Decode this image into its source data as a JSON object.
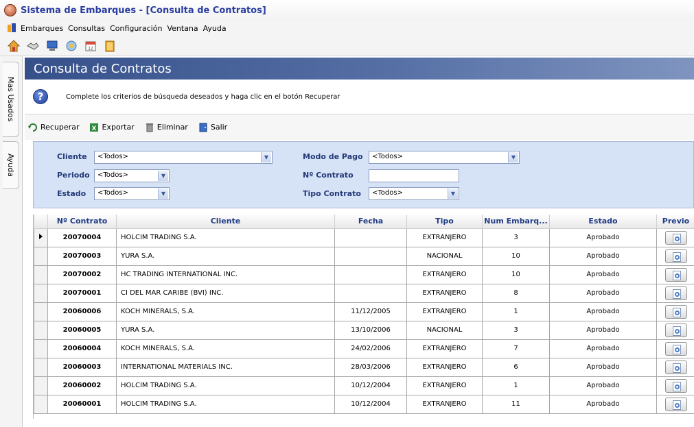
{
  "window": {
    "title": "Sistema de Embarques - [Consulta de Contratos]"
  },
  "menu": [
    "Embarques",
    "Consultas",
    "Configuración",
    "Ventana",
    "Ayuda"
  ],
  "toolbar_icons": [
    "home-icon",
    "handshake-icon",
    "computer-icon",
    "gear-globe-icon",
    "calendar-icon",
    "notebook-icon"
  ],
  "side_tabs": {
    "mas_usados": "Mas Usados",
    "ayuda": "Ayuda"
  },
  "header": {
    "title": "Consulta de Contratos"
  },
  "info": {
    "text": "Complete los criterios de búsqueda deseados y haga clic en el botón Recuperar"
  },
  "actions": {
    "recuperar": "Recuperar",
    "exportar": "Exportar",
    "eliminar": "Eliminar",
    "salir": "Salir"
  },
  "filters": {
    "cliente_label": "Cliente",
    "cliente_value": "<Todos>",
    "periodo_label": "Periodo",
    "periodo_value": "<Todos>",
    "estado_label": "Estado",
    "estado_value": "<Todos>",
    "modo_pago_label": "Modo de Pago",
    "modo_pago_value": "<Todos>",
    "nro_contrato_label": "Nº Contrato",
    "nro_contrato_value": "",
    "tipo_contrato_label": "Tipo Contrato",
    "tipo_contrato_value": "<Todos>"
  },
  "table": {
    "columns": {
      "contrato": "Nº Contrato",
      "cliente": "Cliente",
      "fecha": "Fecha",
      "tipo": "Tipo",
      "embarques": "Num Embarq...",
      "estado": "Estado",
      "previo": "Previo"
    },
    "rows": [
      {
        "contrato": "20070004",
        "cliente": "HOLCIM TRADING S.A.",
        "fecha": "",
        "tipo": "EXTRANJERO",
        "embarques": "3",
        "estado": "Aprobado"
      },
      {
        "contrato": "20070003",
        "cliente": "YURA S.A.",
        "fecha": "",
        "tipo": "NACIONAL",
        "embarques": "10",
        "estado": "Aprobado"
      },
      {
        "contrato": "20070002",
        "cliente": "HC TRADING INTERNATIONAL INC.",
        "fecha": "",
        "tipo": "EXTRANJERO",
        "embarques": "10",
        "estado": "Aprobado"
      },
      {
        "contrato": "20070001",
        "cliente": "CI DEL MAR CARIBE (BVI) INC.",
        "fecha": "",
        "tipo": "EXTRANJERO",
        "embarques": "8",
        "estado": "Aprobado"
      },
      {
        "contrato": "20060006",
        "cliente": "KOCH MINERALS, S.A.",
        "fecha": "11/12/2005",
        "tipo": "EXTRANJERO",
        "embarques": "1",
        "estado": "Aprobado"
      },
      {
        "contrato": "20060005",
        "cliente": "YURA S.A.",
        "fecha": "13/10/2006",
        "tipo": "NACIONAL",
        "embarques": "3",
        "estado": "Aprobado"
      },
      {
        "contrato": "20060004",
        "cliente": "KOCH MINERALS, S.A.",
        "fecha": "24/02/2006",
        "tipo": "EXTRANJERO",
        "embarques": "7",
        "estado": "Aprobado"
      },
      {
        "contrato": "20060003",
        "cliente": "INTERNATIONAL MATERIALS INC.",
        "fecha": "28/03/2006",
        "tipo": "EXTRANJERO",
        "embarques": "6",
        "estado": "Aprobado"
      },
      {
        "contrato": "20060002",
        "cliente": "HOLCIM TRADING S.A.",
        "fecha": "10/12/2004",
        "tipo": "EXTRANJERO",
        "embarques": "1",
        "estado": "Aprobado"
      },
      {
        "contrato": "20060001",
        "cliente": "HOLCIM TRADING S.A.",
        "fecha": "10/12/2004",
        "tipo": "EXTRANJERO",
        "embarques": "11",
        "estado": "Aprobado"
      }
    ]
  }
}
